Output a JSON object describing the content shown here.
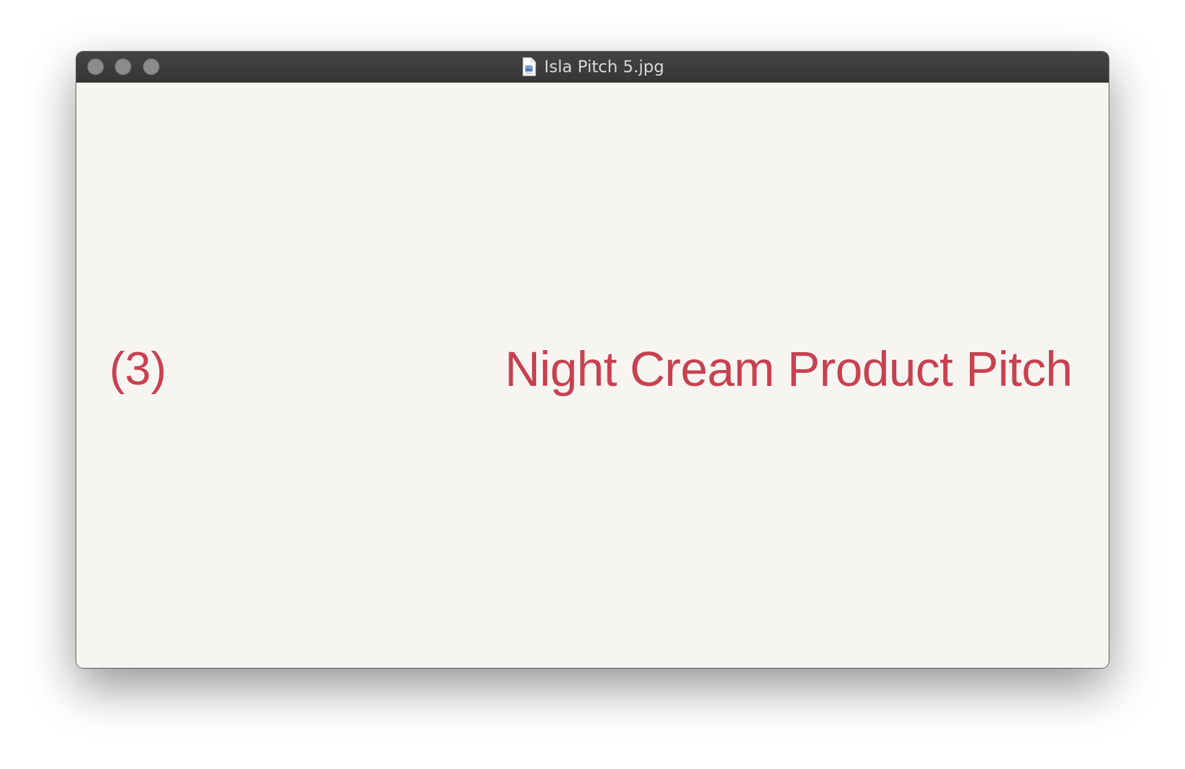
{
  "window": {
    "title": "Isla Pitch 5.jpg",
    "icons": {
      "close": "circle-button",
      "minimize": "circle-button",
      "zoom": "circle-button",
      "file": "image-document-icon"
    }
  },
  "slide": {
    "number": "(3)",
    "headline": "Night Cream Product Pitch",
    "text_color": "#c8414f",
    "background": "#f6f5f2"
  },
  "colors": {
    "titlebar": "#3d3d3d",
    "title_text": "#d8d8d8",
    "traffic_buttons": "#8b8b8b"
  }
}
